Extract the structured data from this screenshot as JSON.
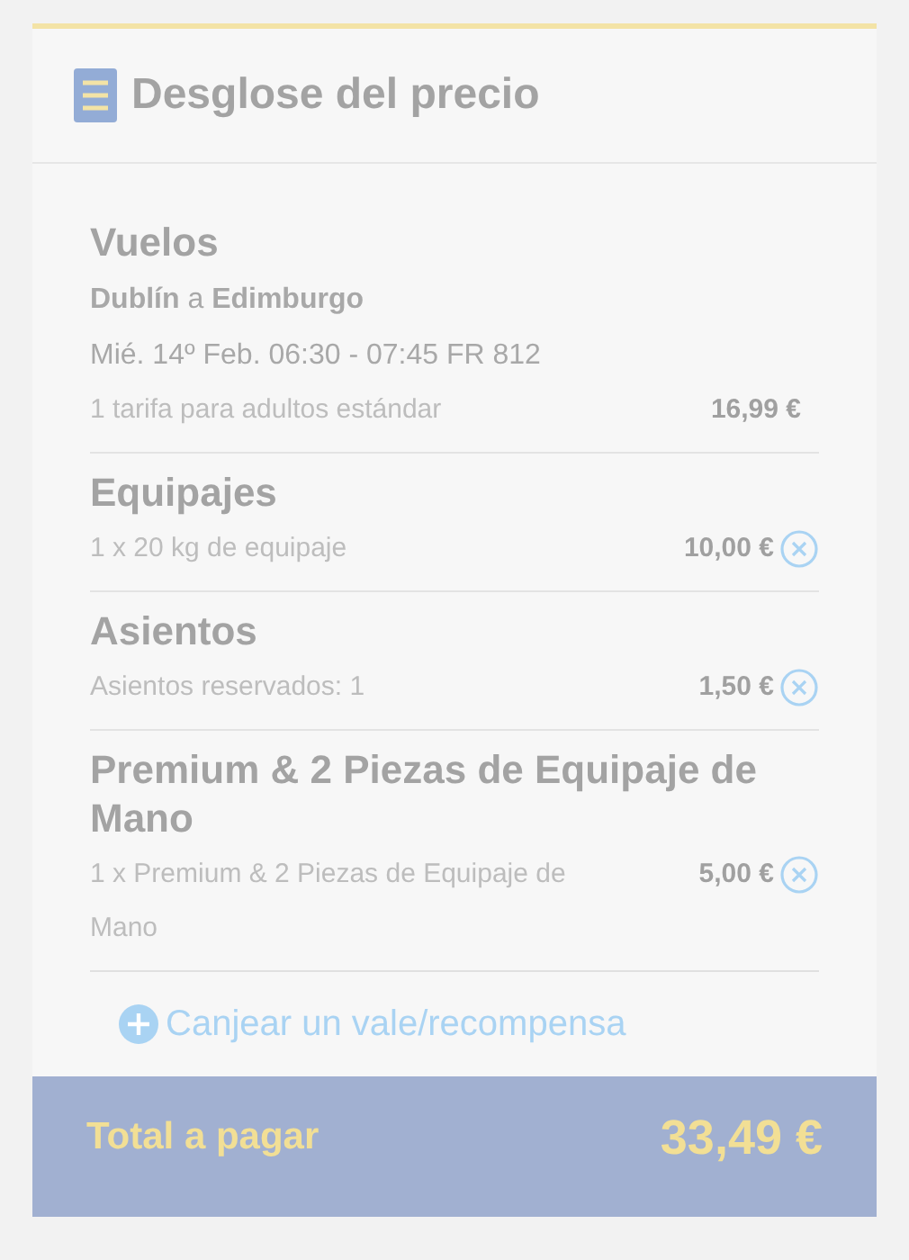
{
  "header": {
    "title": "Desglose del precio"
  },
  "sections": [
    {
      "title": "Vuelos",
      "lines": [
        "**Dublín** a **Edimburgo**",
        "Mié. 14º Feb. 06:30 - 07:45 FR 812"
      ],
      "items": [
        {
          "label": "1 tarifa para adultos estándar",
          "price": "16,99 €",
          "removable": false
        }
      ]
    },
    {
      "title": "Equipajes",
      "items": [
        {
          "label": "1 x 20 kg de equipaje",
          "price": "10,00 €",
          "removable": true
        }
      ]
    },
    {
      "title": "Asientos",
      "items": [
        {
          "label": "Asientos reservados: 1",
          "price": "1,50 €",
          "removable": true
        }
      ]
    },
    {
      "title": "Premium & 2 Piezas de Equipaje de Mano",
      "items": [
        {
          "label": "1 x Premium & 2 Piezas de Equipaje de Mano",
          "price": "5,00 €",
          "removable": true
        }
      ]
    }
  ],
  "voucher_link": "Canjear un vale/recompensa",
  "total": {
    "label": "Total a pagar",
    "amount": "33,49 €"
  }
}
